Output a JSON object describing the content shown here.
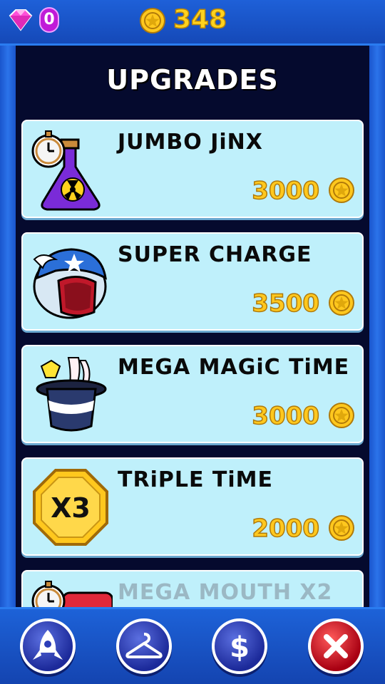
{
  "header": {
    "gem_count": "0",
    "coin_count": "348"
  },
  "panel": {
    "title": "UPGRADES"
  },
  "upgrades": [
    {
      "name": "JUMBO JiNX",
      "price": "3000",
      "icon": "potion-clock-icon"
    },
    {
      "name": "SUPER CHARGE",
      "price": "3500",
      "icon": "winged-helmet-icon"
    },
    {
      "name": "MEGA MAGiC TiME",
      "price": "3000",
      "icon": "magic-hat-icon"
    },
    {
      "name": "TRiPLE TiME",
      "price": "2000",
      "icon": "x3-badge-icon"
    },
    {
      "name": "MEGA MOUTH X2",
      "price": "",
      "icon": "clock-mouth-icon"
    }
  ],
  "x3_badge_text": "X3",
  "bottom_nav": [
    {
      "icon": "rocket-icon"
    },
    {
      "icon": "hanger-icon"
    },
    {
      "icon": "dollar-icon"
    },
    {
      "icon": "close-icon"
    }
  ],
  "colors": {
    "coin": "#ffc81e",
    "card_bg": "#bff0fb",
    "panel_bg": "#050a2e",
    "frame_blue": "#1a4fc4",
    "gem": "#ff4fd8"
  }
}
